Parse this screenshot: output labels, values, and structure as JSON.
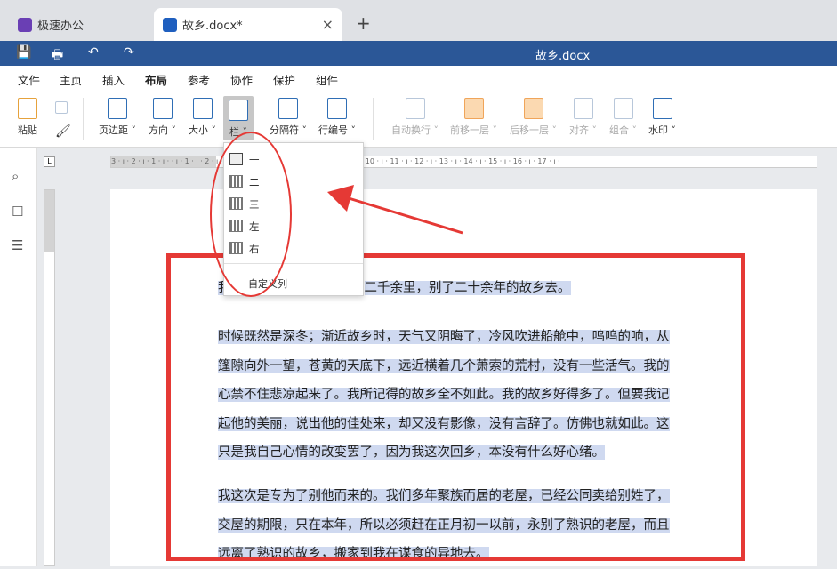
{
  "tabs": [
    {
      "label": "极速办公"
    },
    {
      "label": "故乡.docx*",
      "close": "×"
    }
  ],
  "new_tab": "+",
  "title_bar": {
    "title": "故乡.docx"
  },
  "menu": [
    "文件",
    "主页",
    "插入",
    "布局",
    "参考",
    "协作",
    "保护",
    "组件"
  ],
  "menu_active": "布局",
  "ribbon": {
    "paste": "粘贴",
    "margins": "页边距 ˅",
    "orientation": "方向 ˅",
    "size": "大小 ˅",
    "columns": "栏 ˅",
    "breaks": "分隔符 ˅",
    "line_numbers": "行编号 ˅",
    "wrap": "自动换行 ˅",
    "bring_forward": "前移一层 ˅",
    "send_backward": "后移一层 ˅",
    "align": "对齐 ˅",
    "group": "组合 ˅",
    "watermark": "水印 ˅"
  },
  "ruler": {
    "corner": "L",
    "marks": "3 · ı · 2 · ı · 1 · ı ·       · ı · 1 · ı · 2 · ı · 3 · ı · 4 · ı · 5 · ı · 6 · ı · 7 · ı · 8 · ı · 9 · ı · 10 · ı · 11 · ı · 12 · ı · 13 · ı · 14 · ı · 15 · ı · 16 · ı · 17 · ı ·"
  },
  "columns_menu": {
    "items": [
      "一",
      "二",
      "三",
      "左",
      "右"
    ],
    "custom": "自定义列"
  },
  "document": {
    "paragraphs": [
      [
        "我",
        "二千余里，别了二十余年的故乡去。"
      ],
      [
        "时候既然是深冬；渐近故乡时，天气又阴晦了，冷风吹进船舱中，呜呜的响，从",
        "篷隙向外一望，苍黄的天底下，远近横着几个萧索的荒村，没有一些活气。我的",
        "心禁不住悲凉起来了。我所记得的故乡全不如此。我的故乡好得多了。但要我记",
        "起他的美丽，说出他的佳处来，却又没有影像，没有言辞了。仿佛也就如此。这",
        "只是我自己心情的改变罢了，因为我这次回乡，本没有什么好心绪。"
      ],
      [
        "我这次是专为了别他而来的。我们多年聚族而居的老屋，已经公同卖给别姓了，",
        "交屋的期限，只在本年，所以必须赶在正月初一以前，永别了熟识的老屋，而且",
        "远离了熟识的故乡，搬家到我在谋食的异地去。"
      ]
    ]
  },
  "colors": {
    "title_bar": "#2b5797",
    "annotation": "#e53935",
    "selection": "#cfd9f0"
  }
}
